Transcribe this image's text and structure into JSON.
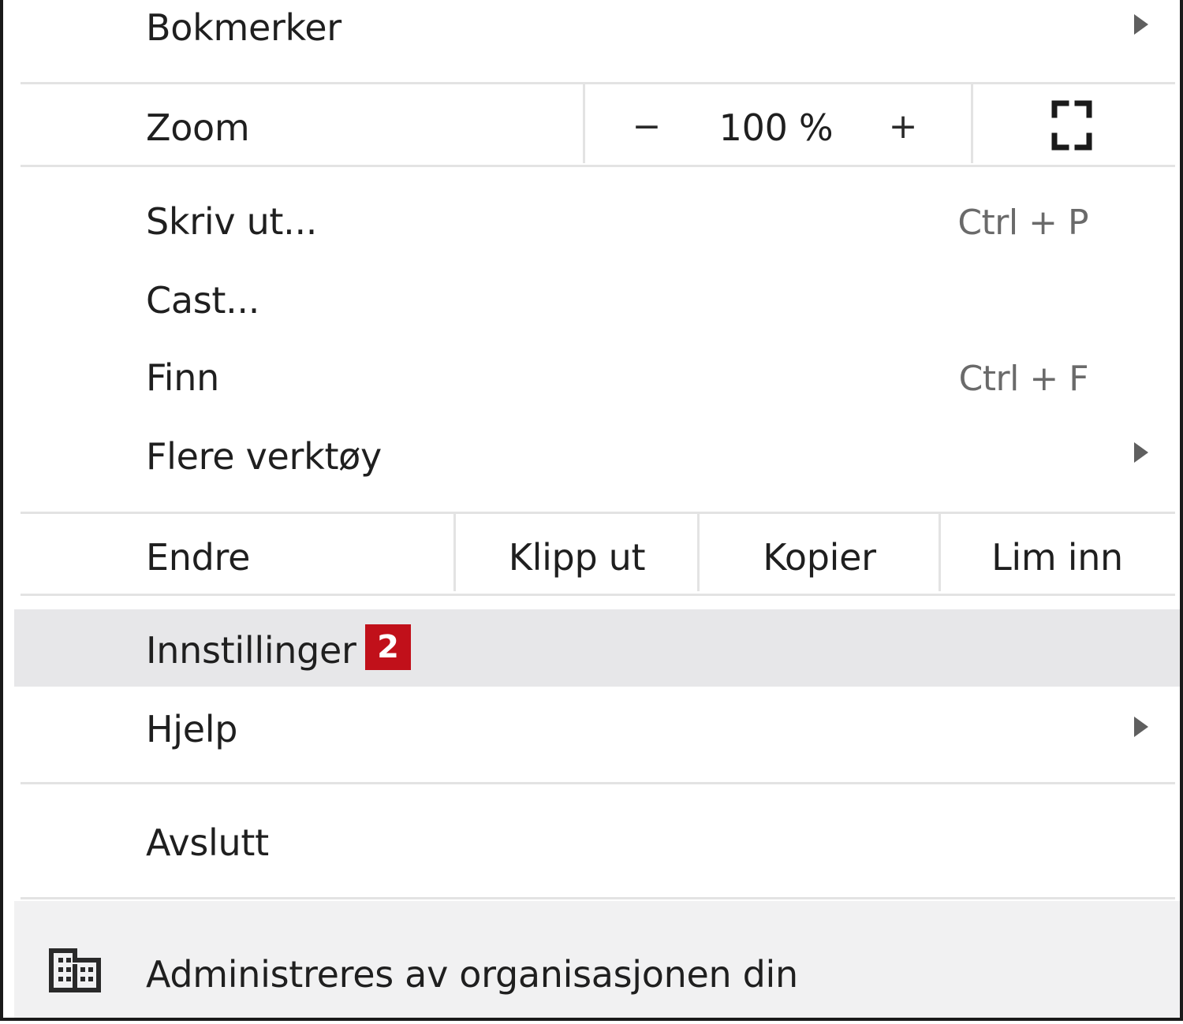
{
  "menu": {
    "bookmarks": {
      "label": "Bokmerker",
      "has_submenu": true
    },
    "zoom": {
      "label": "Zoom",
      "decrease": "−",
      "level": "100 %",
      "increase": "+",
      "fullscreen_icon": "fullscreen-icon"
    },
    "print": {
      "label": "Skriv ut...",
      "shortcut": "Ctrl + P"
    },
    "cast": {
      "label": "Cast..."
    },
    "find": {
      "label": "Finn",
      "shortcut": "Ctrl + F"
    },
    "more_tools": {
      "label": "Flere verktøy",
      "has_submenu": true
    },
    "edit": {
      "label": "Endre",
      "cut": "Klipp ut",
      "copy": "Kopier",
      "paste": "Lim inn"
    },
    "settings": {
      "label": "Innstillinger",
      "badge": "2",
      "badge_color": "#c1101a",
      "highlighted": true
    },
    "help": {
      "label": "Hjelp",
      "has_submenu": true
    },
    "exit": {
      "label": "Avslutt"
    },
    "managed": {
      "label": "Administreres av organisasjonen din",
      "icon": "building-icon"
    }
  }
}
